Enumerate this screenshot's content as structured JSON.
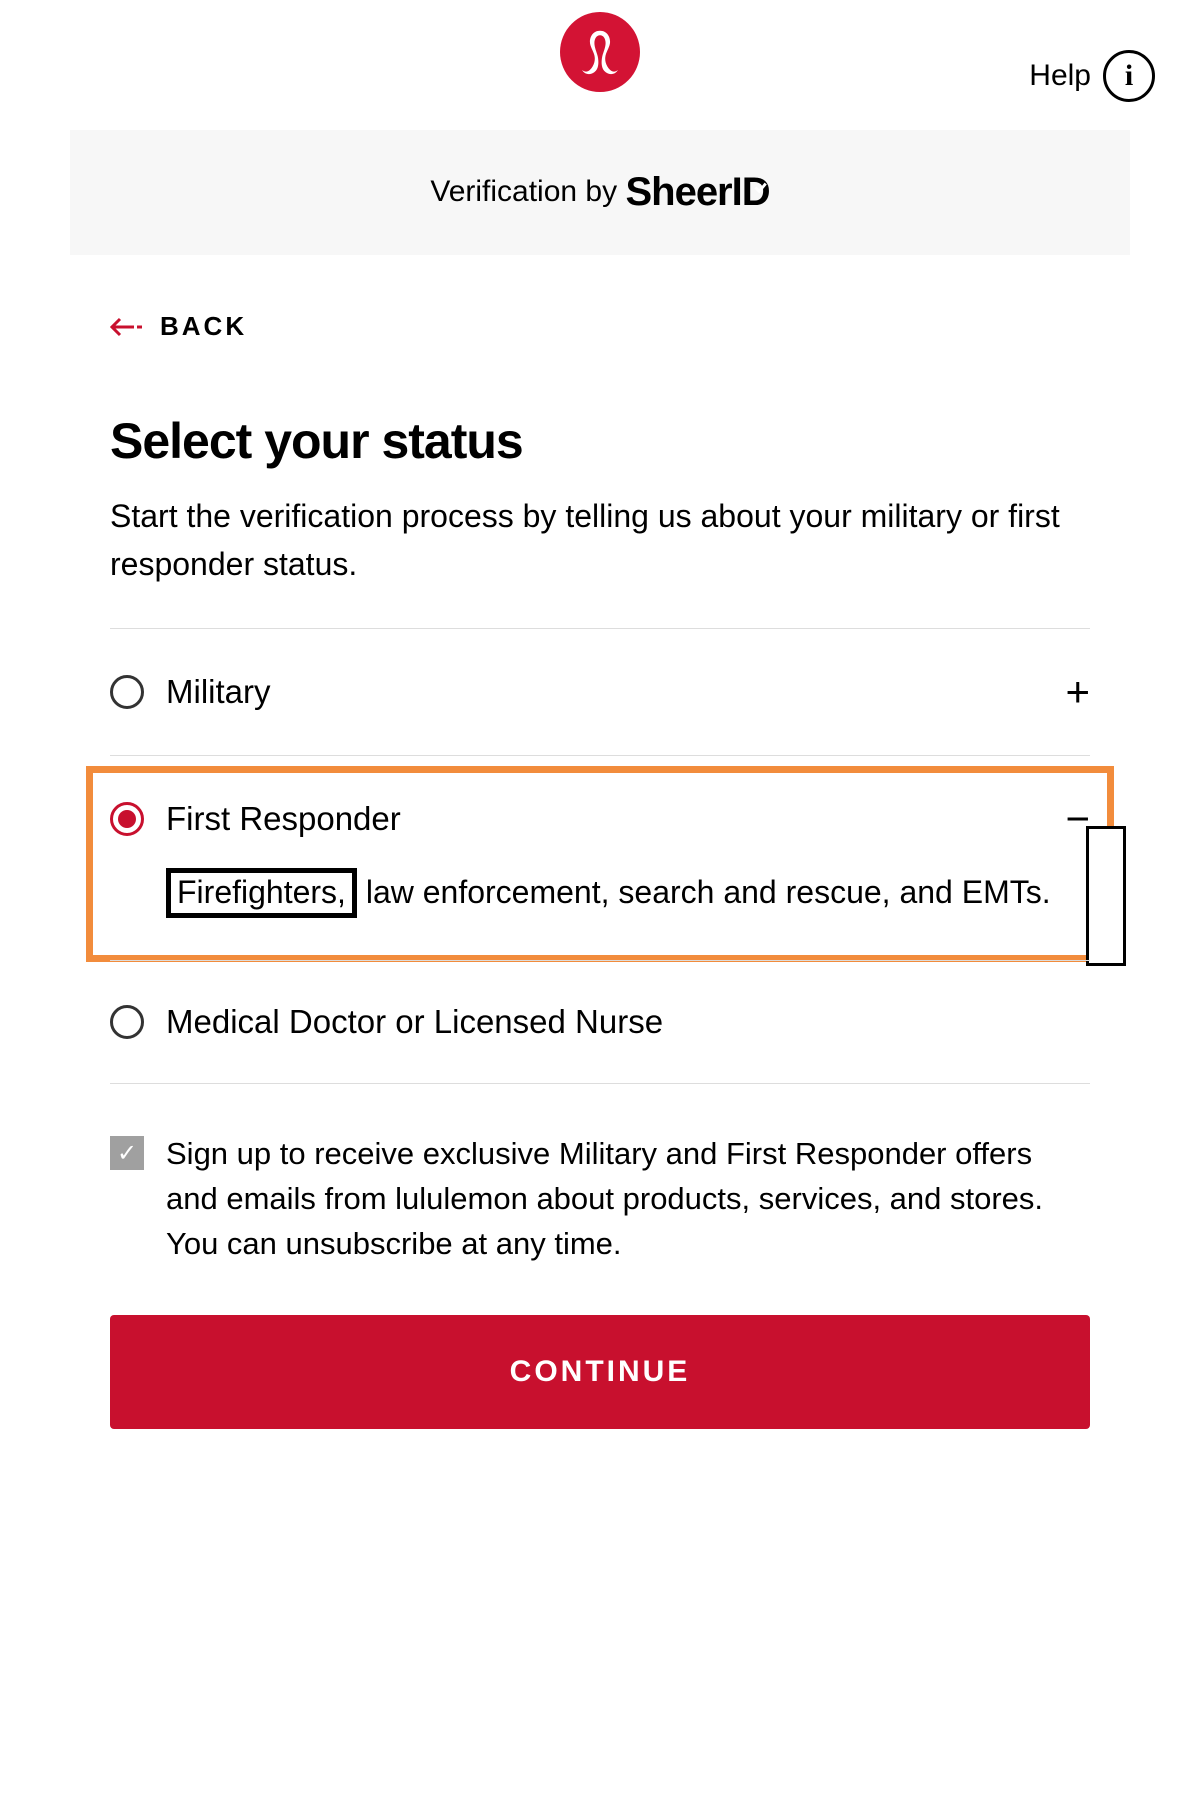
{
  "header": {
    "help_label": "Help"
  },
  "verification": {
    "prefix": "Verification by ",
    "brand": "SheerID"
  },
  "back_label": "BACK",
  "title": "Select your status",
  "subtitle": "Start the verification process by telling us about your military or first responder status.",
  "options": [
    {
      "label": "Military",
      "selected": false,
      "expanded": false
    },
    {
      "label": "First Responder",
      "selected": true,
      "expanded": true,
      "desc_boxed_word": "Firefighters,",
      "desc_rest": " law enforcement, search and rescue, and EMTs."
    },
    {
      "label": "Medical Doctor or Licensed Nurse",
      "selected": false,
      "expanded": false
    }
  ],
  "consent": {
    "checked": true,
    "text": "Sign up to receive exclusive Military and First Responder offers and emails from lululemon about products, services, and stores. You can unsubscribe at any time."
  },
  "continue_label": "CONTINUE",
  "icons": {
    "plus": "+",
    "minus": "−",
    "check": "✓"
  },
  "colors": {
    "brand_red": "#c8102e",
    "logo_red": "#d31334",
    "highlight_orange": "#f28c3c"
  }
}
